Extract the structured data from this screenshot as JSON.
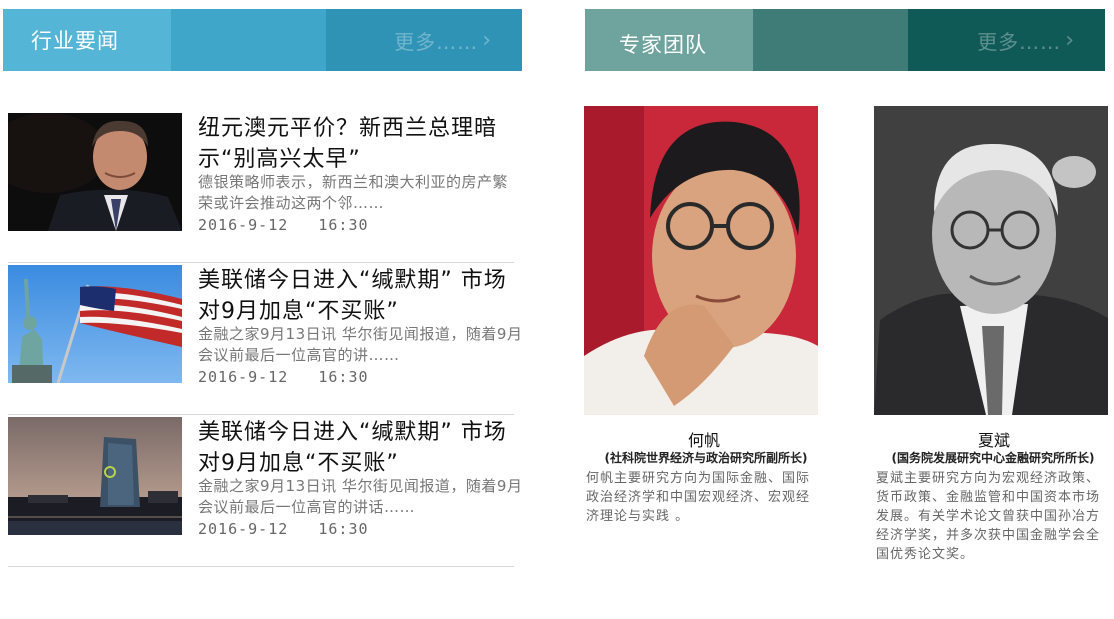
{
  "industry_news": {
    "title": "行业要闻",
    "more_label": "更多……",
    "more_icon": "chevron-right-icon",
    "items": [
      {
        "title": "纽元澳元平价？新西兰总理暗示“别高兴太早”",
        "summary": "德银策略师表示，新西兰和澳大利亚的房产繁荣或许会推动这两个邻……",
        "date": "2016-9-12",
        "time": "16:30"
      },
      {
        "title": "美联储今日进入“缄默期” 市场对9月加息“不买账”",
        "summary": "金融之家9月13日讯 华尔街见闻报道，随着9月会议前最后一位高官的讲……",
        "date": "2016-9-12",
        "time": "16:30"
      },
      {
        "title": "美联储今日进入“缄默期” 市场对9月加息“不买账”",
        "summary": "金融之家9月13日讯 华尔街见闻报道，随着9月会议前最后一位高官的讲话……",
        "date": "2016-9-12",
        "time": "16:30"
      }
    ]
  },
  "expert_team": {
    "title": "专家团队",
    "more_label": "更多……",
    "more_icon": "chevron-right-icon",
    "experts": [
      {
        "name": "何帆",
        "title": "(社科院世界经济与政治研究所副所长)",
        "description": "何帆主要研究方向为国际金融、国际政治经济学和中国宏观经济、宏观经济理论与实践 。"
      },
      {
        "name": "夏斌",
        "title": "(国务院发展研究中心金融研究所所长)",
        "description": "夏斌主要研究方向为宏观经济政策、货币政策、金融监管和中国资本市场发展。有关学术论文曾获中国孙冶方经济学奖，并多次获中国金融学会全国优秀论文奖。"
      }
    ]
  },
  "colors": {
    "news_bar": [
      "#55b5d6",
      "#3fa6c9",
      "#2f93b6"
    ],
    "expert_bar": [
      "#6ea39e",
      "#3f7b77",
      "#0f5a57"
    ]
  }
}
